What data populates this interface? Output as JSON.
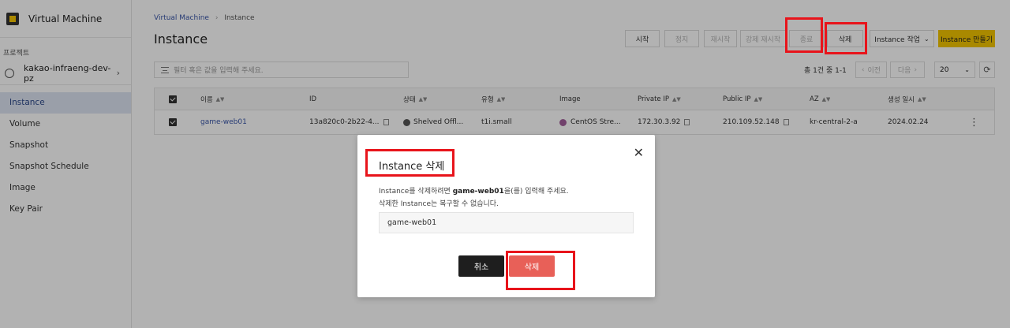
{
  "app": {
    "title": "Virtual Machine"
  },
  "sidebar": {
    "project_label": "프로젝트",
    "project_name": "kakao-infraeng-dev-pz",
    "items": [
      {
        "label": "Instance",
        "active": true
      },
      {
        "label": "Volume"
      },
      {
        "label": "Snapshot"
      },
      {
        "label": "Snapshot Schedule"
      },
      {
        "label": "Image"
      },
      {
        "label": "Key Pair"
      }
    ]
  },
  "breadcrumb": {
    "root": "Virtual Machine",
    "current": "Instance"
  },
  "page_title": "Instance",
  "toolbar": {
    "start": "시작",
    "stop": "정지",
    "restart": "재시작",
    "force_restart": "강제 재시작",
    "terminate": "종료",
    "delete": "삭제",
    "instance_action": "Instance 작업",
    "create": "Instance 만들기"
  },
  "filter": {
    "placeholder": "필터 혹은 값을 입력해 주세요."
  },
  "pagination": {
    "summary": "총 1건 중 1-1",
    "prev": "이전",
    "next": "다음",
    "per_page": "20"
  },
  "table": {
    "headers": [
      "이름",
      "ID",
      "상태",
      "유형",
      "Image",
      "Private IP",
      "Public IP",
      "AZ",
      "생성 일시"
    ],
    "rows": [
      {
        "name": "game-web01",
        "id": "13a820c0-2b22-4...",
        "status": "Shelved Offl...",
        "type": "t1i.small",
        "image": "CentOS Stre...",
        "private_ip": "172.30.3.92",
        "public_ip": "210.109.52.148",
        "az": "kr-central-2-a",
        "created": "2024.02.24"
      }
    ]
  },
  "modal": {
    "title": "Instance 삭제",
    "desc_prefix": "Instance를 삭제하려면 ",
    "desc_name": "game-web01",
    "desc_suffix": "을(를) 입력해 주세요.",
    "desc2": "삭제한 Instance는 복구할 수 없습니다.",
    "input_value": "game-web01",
    "cancel": "취소",
    "confirm": "삭제"
  },
  "colors": {
    "accent": "#f2c500",
    "danger": "#e86058",
    "highlight": "#e8141b",
    "link": "#3a56a8"
  }
}
